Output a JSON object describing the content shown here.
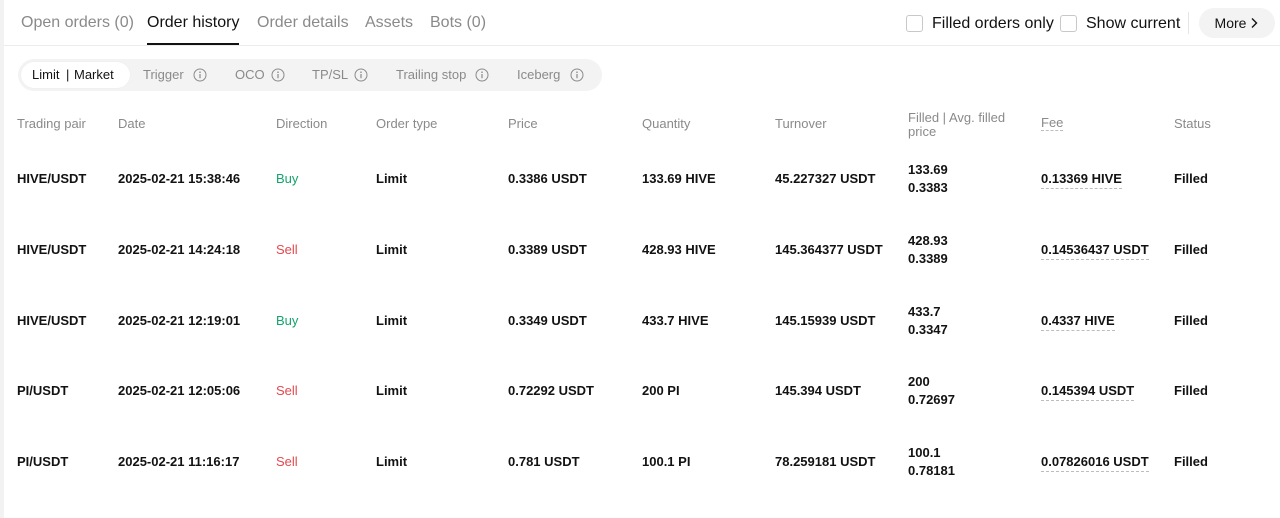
{
  "tabs": [
    {
      "label": "Open orders (0)",
      "active": false
    },
    {
      "label": "Order history",
      "active": true
    },
    {
      "label": "Order details",
      "active": false
    },
    {
      "label": "Assets",
      "active": false
    },
    {
      "label": "Bots (0)",
      "active": false
    }
  ],
  "filters": {
    "filled_orders_only": {
      "label": "Filled orders only",
      "checked": false
    },
    "show_current": {
      "label": "Show current",
      "checked": false
    },
    "more_label": "More",
    "more_icon": "chevron-right-icon"
  },
  "order_types": {
    "active_left": "Limit",
    "separator": "|",
    "active_right": "Market",
    "items": [
      {
        "label": "Trigger",
        "icon": "info-icon"
      },
      {
        "label": "OCO",
        "icon": "info-icon"
      },
      {
        "label": "TP/SL",
        "icon": "info-icon"
      },
      {
        "label": "Trailing stop",
        "icon": "info-icon"
      },
      {
        "label": "Iceberg",
        "icon": "info-icon"
      }
    ]
  },
  "table": {
    "columns": {
      "pair": "Trading pair",
      "date": "Date",
      "direction": "Direction",
      "order_type": "Order type",
      "price": "Price",
      "quantity": "Quantity",
      "turnover": "Turnover",
      "filled_line1": "Filled | Avg. filled",
      "filled_line2": "price",
      "fee": "Fee",
      "status": "Status"
    },
    "rows": [
      {
        "pair": "HIVE/USDT",
        "date": "2025-02-21 15:38:46",
        "direction": "Buy",
        "order_type": "Limit",
        "price": "0.3386 USDT",
        "quantity": "133.69 HIVE",
        "turnover": "45.227327 USDT",
        "filled": "133.69",
        "avg_price": "0.3383",
        "fee": "0.13369 HIVE",
        "status": "Filled"
      },
      {
        "pair": "HIVE/USDT",
        "date": "2025-02-21 14:24:18",
        "direction": "Sell",
        "order_type": "Limit",
        "price": "0.3389 USDT",
        "quantity": "428.93 HIVE",
        "turnover": "145.364377 USDT",
        "filled": "428.93",
        "avg_price": "0.3389",
        "fee": "0.14536437 USDT",
        "status": "Filled"
      },
      {
        "pair": "HIVE/USDT",
        "date": "2025-02-21 12:19:01",
        "direction": "Buy",
        "order_type": "Limit",
        "price": "0.3349 USDT",
        "quantity": "433.7 HIVE",
        "turnover": "145.15939 USDT",
        "filled": "433.7",
        "avg_price": "0.3347",
        "fee": "0.4337 HIVE",
        "status": "Filled"
      },
      {
        "pair": "PI/USDT",
        "date": "2025-02-21 12:05:06",
        "direction": "Sell",
        "order_type": "Limit",
        "price": "0.72292 USDT",
        "quantity": "200 PI",
        "turnover": "145.394 USDT",
        "filled": "200",
        "avg_price": "0.72697",
        "fee": "0.145394 USDT",
        "status": "Filled"
      },
      {
        "pair": "PI/USDT",
        "date": "2025-02-21 11:16:17",
        "direction": "Sell",
        "order_type": "Limit",
        "price": "0.781 USDT",
        "quantity": "100.1 PI",
        "turnover": "78.259181 USDT",
        "filled": "100.1",
        "avg_price": "0.78181",
        "fee": "0.07826016 USDT",
        "status": "Filled"
      }
    ]
  },
  "colors": {
    "buy": "#14a36b",
    "sell": "#e5484d",
    "muted": "#8a8a8a",
    "text": "#121212"
  }
}
